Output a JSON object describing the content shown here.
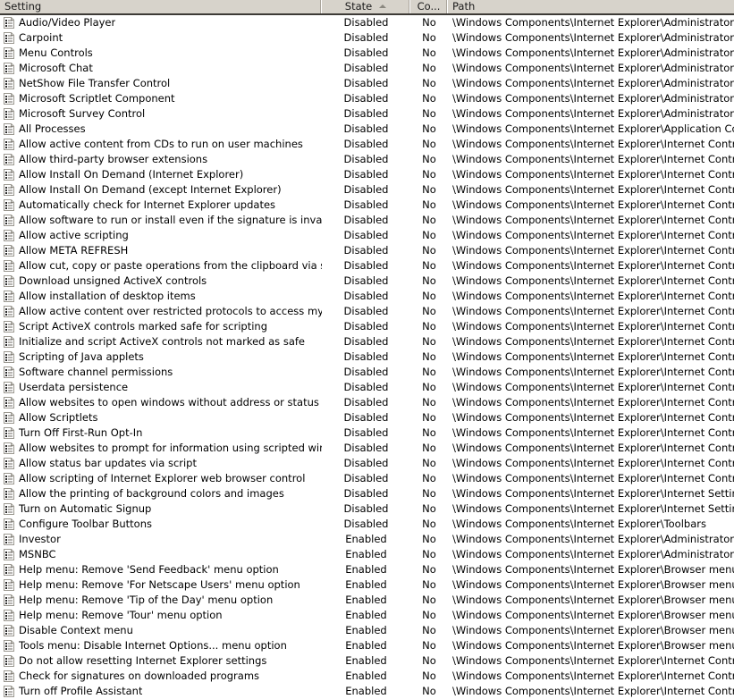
{
  "columns": {
    "setting": "Setting",
    "state": "State",
    "comment": "Co...",
    "path": "Path",
    "sort_column": "State",
    "sort_direction": "ascending"
  },
  "colors": {
    "header_background": "#d7d3cb",
    "header_border": "#3d3a36",
    "row_background": "#ffffff",
    "text": "#000000",
    "sort_arrow": "#8b8880"
  },
  "icon_name": "policy-setting-icon",
  "rows": [
    {
      "setting": "Audio/Video Player",
      "state": "Disabled",
      "comment": "No",
      "path": "\\Windows Components\\Internet Explorer\\Administrator Approved"
    },
    {
      "setting": "Carpoint",
      "state": "Disabled",
      "comment": "No",
      "path": "\\Windows Components\\Internet Explorer\\Administrator Approved"
    },
    {
      "setting": "Menu Controls",
      "state": "Disabled",
      "comment": "No",
      "path": "\\Windows Components\\Internet Explorer\\Administrator Approved"
    },
    {
      "setting": "Microsoft Chat",
      "state": "Disabled",
      "comment": "No",
      "path": "\\Windows Components\\Internet Explorer\\Administrator Approved"
    },
    {
      "setting": "NetShow File Transfer Control",
      "state": "Disabled",
      "comment": "No",
      "path": "\\Windows Components\\Internet Explorer\\Administrator Approved"
    },
    {
      "setting": "Microsoft Scriptlet Component",
      "state": "Disabled",
      "comment": "No",
      "path": "\\Windows Components\\Internet Explorer\\Administrator Approved"
    },
    {
      "setting": "Microsoft Survey Control",
      "state": "Disabled",
      "comment": "No",
      "path": "\\Windows Components\\Internet Explorer\\Administrator Approved"
    },
    {
      "setting": "All Processes",
      "state": "Disabled",
      "comment": "No",
      "path": "\\Windows Components\\Internet Explorer\\Application Compatibility"
    },
    {
      "setting": "Allow active content from CDs to run on user machines",
      "state": "Disabled",
      "comment": "No",
      "path": "\\Windows Components\\Internet Explorer\\Internet Control Panel\\"
    },
    {
      "setting": "Allow third-party browser extensions",
      "state": "Disabled",
      "comment": "No",
      "path": "\\Windows Components\\Internet Explorer\\Internet Control Panel\\"
    },
    {
      "setting": "Allow Install On Demand (Internet Explorer)",
      "state": "Disabled",
      "comment": "No",
      "path": "\\Windows Components\\Internet Explorer\\Internet Control Panel\\"
    },
    {
      "setting": "Allow Install On Demand (except Internet Explorer)",
      "state": "Disabled",
      "comment": "No",
      "path": "\\Windows Components\\Internet Explorer\\Internet Control Panel\\"
    },
    {
      "setting": "Automatically check for Internet Explorer updates",
      "state": "Disabled",
      "comment": "No",
      "path": "\\Windows Components\\Internet Explorer\\Internet Control Panel\\"
    },
    {
      "setting": "Allow software to run or install even if the signature is invalid",
      "state": "Disabled",
      "comment": "No",
      "path": "\\Windows Components\\Internet Explorer\\Internet Control Panel\\"
    },
    {
      "setting": "Allow active scripting",
      "state": "Disabled",
      "comment": "No",
      "path": "\\Windows Components\\Internet Explorer\\Internet Control Panel\\"
    },
    {
      "setting": "Allow META REFRESH",
      "state": "Disabled",
      "comment": "No",
      "path": "\\Windows Components\\Internet Explorer\\Internet Control Panel\\"
    },
    {
      "setting": "Allow cut, copy or paste operations from the clipboard via script",
      "state": "Disabled",
      "comment": "No",
      "path": "\\Windows Components\\Internet Explorer\\Internet Control Panel\\"
    },
    {
      "setting": "Download unsigned ActiveX controls",
      "state": "Disabled",
      "comment": "No",
      "path": "\\Windows Components\\Internet Explorer\\Internet Control Panel\\"
    },
    {
      "setting": "Allow installation of desktop items",
      "state": "Disabled",
      "comment": "No",
      "path": "\\Windows Components\\Internet Explorer\\Internet Control Panel\\"
    },
    {
      "setting": "Allow active content over restricted protocols to access my computer",
      "state": "Disabled",
      "comment": "No",
      "path": "\\Windows Components\\Internet Explorer\\Internet Control Panel\\"
    },
    {
      "setting": "Script ActiveX controls marked safe for scripting",
      "state": "Disabled",
      "comment": "No",
      "path": "\\Windows Components\\Internet Explorer\\Internet Control Panel\\"
    },
    {
      "setting": "Initialize and script ActiveX controls not marked as safe",
      "state": "Disabled",
      "comment": "No",
      "path": "\\Windows Components\\Internet Explorer\\Internet Control Panel\\"
    },
    {
      "setting": "Scripting of Java applets",
      "state": "Disabled",
      "comment": "No",
      "path": "\\Windows Components\\Internet Explorer\\Internet Control Panel\\"
    },
    {
      "setting": "Software channel permissions",
      "state": "Disabled",
      "comment": "No",
      "path": "\\Windows Components\\Internet Explorer\\Internet Control Panel\\"
    },
    {
      "setting": "Userdata persistence",
      "state": "Disabled",
      "comment": "No",
      "path": "\\Windows Components\\Internet Explorer\\Internet Control Panel\\"
    },
    {
      "setting": "Allow websites to open windows without address or status bars",
      "state": "Disabled",
      "comment": "No",
      "path": "\\Windows Components\\Internet Explorer\\Internet Control Panel\\"
    },
    {
      "setting": "Allow Scriptlets",
      "state": "Disabled",
      "comment": "No",
      "path": "\\Windows Components\\Internet Explorer\\Internet Control Panel\\"
    },
    {
      "setting": "Turn Off First-Run Opt-In",
      "state": "Disabled",
      "comment": "No",
      "path": "\\Windows Components\\Internet Explorer\\Internet Control Panel\\"
    },
    {
      "setting": "Allow websites to prompt for information using scripted windows",
      "state": "Disabled",
      "comment": "No",
      "path": "\\Windows Components\\Internet Explorer\\Internet Control Panel\\"
    },
    {
      "setting": "Allow status bar updates via script",
      "state": "Disabled",
      "comment": "No",
      "path": "\\Windows Components\\Internet Explorer\\Internet Control Panel\\"
    },
    {
      "setting": "Allow scripting of Internet Explorer web browser control",
      "state": "Disabled",
      "comment": "No",
      "path": "\\Windows Components\\Internet Explorer\\Internet Control Panel\\"
    },
    {
      "setting": "Allow the printing of background colors and images",
      "state": "Disabled",
      "comment": "No",
      "path": "\\Windows Components\\Internet Explorer\\Internet Settings\\Advan"
    },
    {
      "setting": "Turn on Automatic Signup",
      "state": "Disabled",
      "comment": "No",
      "path": "\\Windows Components\\Internet Explorer\\Internet Settings\\Advan"
    },
    {
      "setting": "Configure Toolbar Buttons",
      "state": "Disabled",
      "comment": "No",
      "path": "\\Windows Components\\Internet Explorer\\Toolbars"
    },
    {
      "setting": "Investor",
      "state": "Enabled",
      "comment": "No",
      "path": "\\Windows Components\\Internet Explorer\\Administrator Approved"
    },
    {
      "setting": "MSNBC",
      "state": "Enabled",
      "comment": "No",
      "path": "\\Windows Components\\Internet Explorer\\Administrator Approved"
    },
    {
      "setting": "Help menu: Remove 'Send Feedback' menu option",
      "state": "Enabled",
      "comment": "No",
      "path": "\\Windows Components\\Internet Explorer\\Browser menus"
    },
    {
      "setting": "Help menu: Remove 'For Netscape Users' menu option",
      "state": "Enabled",
      "comment": "No",
      "path": "\\Windows Components\\Internet Explorer\\Browser menus"
    },
    {
      "setting": "Help menu: Remove 'Tip of the Day' menu option",
      "state": "Enabled",
      "comment": "No",
      "path": "\\Windows Components\\Internet Explorer\\Browser menus"
    },
    {
      "setting": "Help menu: Remove 'Tour' menu option",
      "state": "Enabled",
      "comment": "No",
      "path": "\\Windows Components\\Internet Explorer\\Browser menus"
    },
    {
      "setting": "Disable Context menu",
      "state": "Enabled",
      "comment": "No",
      "path": "\\Windows Components\\Internet Explorer\\Browser menus"
    },
    {
      "setting": "Tools menu: Disable Internet Options... menu option",
      "state": "Enabled",
      "comment": "No",
      "path": "\\Windows Components\\Internet Explorer\\Browser menus"
    },
    {
      "setting": "Do not allow resetting Internet Explorer settings",
      "state": "Enabled",
      "comment": "No",
      "path": "\\Windows Components\\Internet Explorer\\Internet Control Panel\\"
    },
    {
      "setting": "Check for signatures on downloaded programs",
      "state": "Enabled",
      "comment": "No",
      "path": "\\Windows Components\\Internet Explorer\\Internet Control Panel\\"
    },
    {
      "setting": "Turn off Profile Assistant",
      "state": "Enabled",
      "comment": "No",
      "path": "\\Windows Components\\Internet Explorer\\Internet Control Panel\\"
    }
  ]
}
